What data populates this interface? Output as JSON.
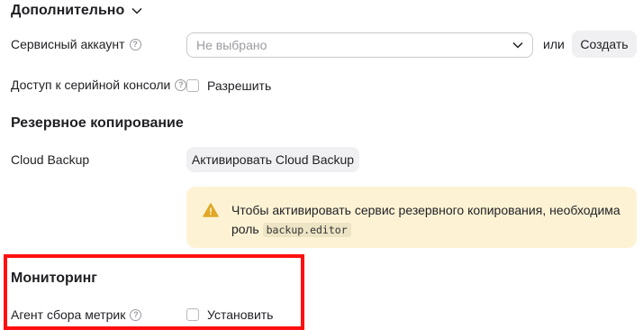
{
  "additional": {
    "title": "Дополнительно",
    "service_account": {
      "label": "Сервисный аккаунт",
      "select_placeholder": "Не выбрано",
      "or_text": "или",
      "create_button": "Создать"
    },
    "serial_console": {
      "label": "Доступ к серийной консоли",
      "checkbox_label": "Разрешить"
    }
  },
  "backup": {
    "title": "Резервное копирование",
    "cloud_backup_label": "Cloud Backup",
    "activate_button": "Активировать Cloud Backup",
    "alert_text_before": "Чтобы активировать сервис резервного копирования, необходима",
    "alert_text_role": "роль",
    "alert_code": "backup.editor",
    "alert_color": "#fdf3d4"
  },
  "monitoring": {
    "title": "Мониторинг",
    "agent_label": "Агент сбора метрик",
    "checkbox_label": "Установить",
    "highlight_color": "#ff1010"
  }
}
